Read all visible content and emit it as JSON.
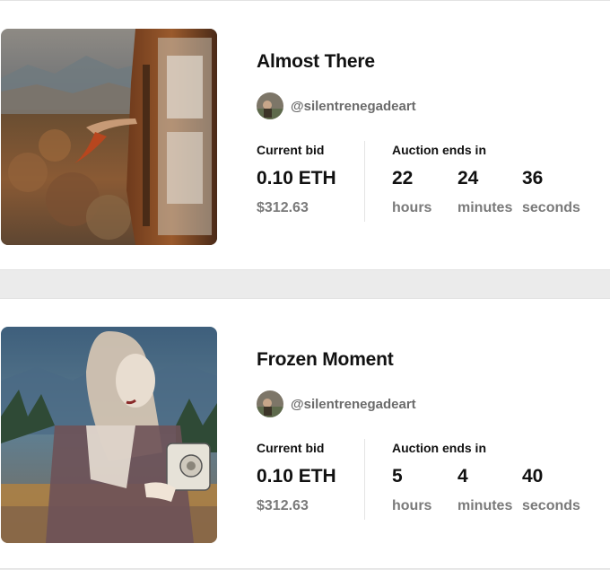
{
  "auctions": [
    {
      "title": "Almost There",
      "creator": "@silentrenegadeart",
      "bid_label": "Current bid",
      "bid_amount": "0.10 ETH",
      "bid_usd": "$312.63",
      "ends_label": "Auction ends in",
      "countdown": [
        {
          "value": "22",
          "unit": "hours"
        },
        {
          "value": "24",
          "unit": "minutes"
        },
        {
          "value": "36",
          "unit": "seconds"
        }
      ]
    },
    {
      "title": "Frozen Moment",
      "creator": "@silentrenegadeart",
      "bid_label": "Current bid",
      "bid_amount": "0.10 ETH",
      "bid_usd": "$312.63",
      "ends_label": "Auction ends in",
      "countdown": [
        {
          "value": "5",
          "unit": "hours"
        },
        {
          "value": "4",
          "unit": "minutes"
        },
        {
          "value": "40",
          "unit": "seconds"
        }
      ]
    }
  ]
}
